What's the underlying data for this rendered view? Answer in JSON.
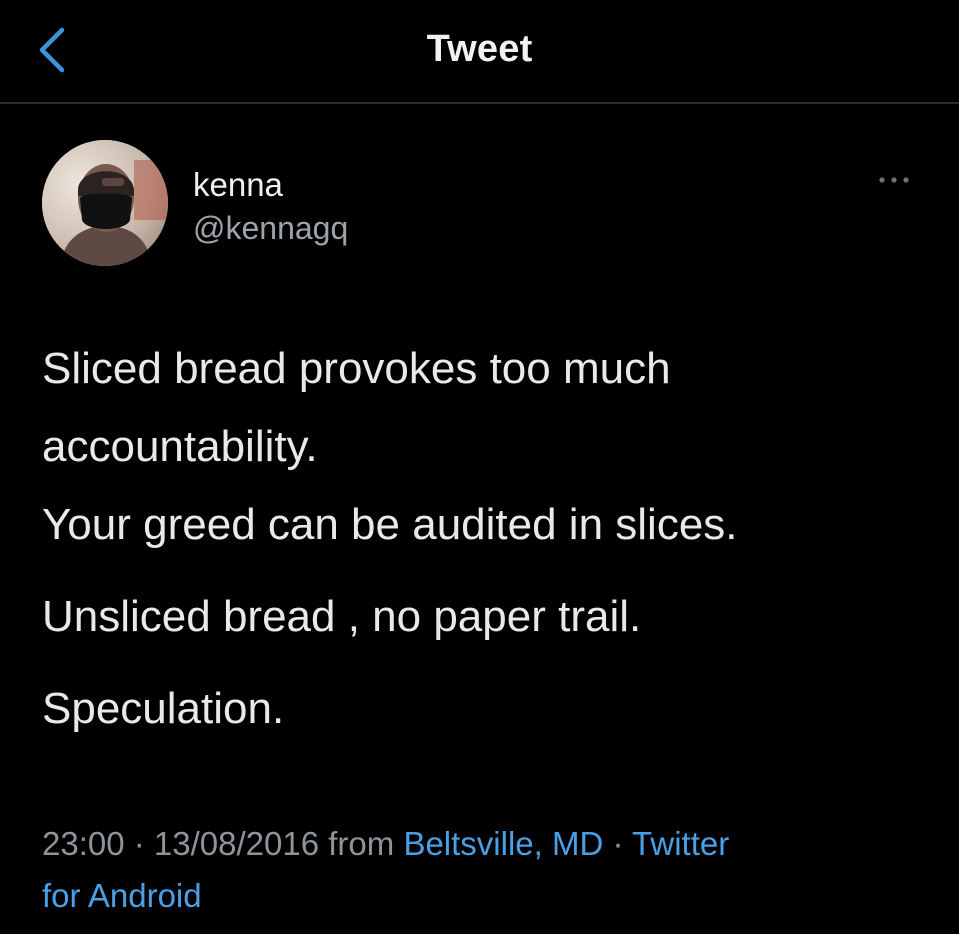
{
  "header": {
    "title": "Tweet"
  },
  "tweet": {
    "author": {
      "display_name": "kenna",
      "handle": "@kennagq"
    },
    "text_lines": [
      "Sliced bread provokes too much",
      "accountability.",
      "Your greed can be audited in slices.",
      "Unsliced bread , no paper trail.",
      "Speculation."
    ],
    "meta": {
      "time": "23:00",
      "separator1": " · ",
      "date": "13/08/2016",
      "from_label": " from ",
      "location": "Beltsville, MD",
      "separator2": " · ",
      "source_part1": "Twitter",
      "source_part2": "for Android"
    }
  },
  "colors": {
    "background": "#000000",
    "link": "#4aa0e6",
    "muted_text": "#8e9499",
    "divider": "#2b2b2b"
  },
  "icons": {
    "back": "chevron-left-icon",
    "more": "more-horizontal-icon"
  }
}
